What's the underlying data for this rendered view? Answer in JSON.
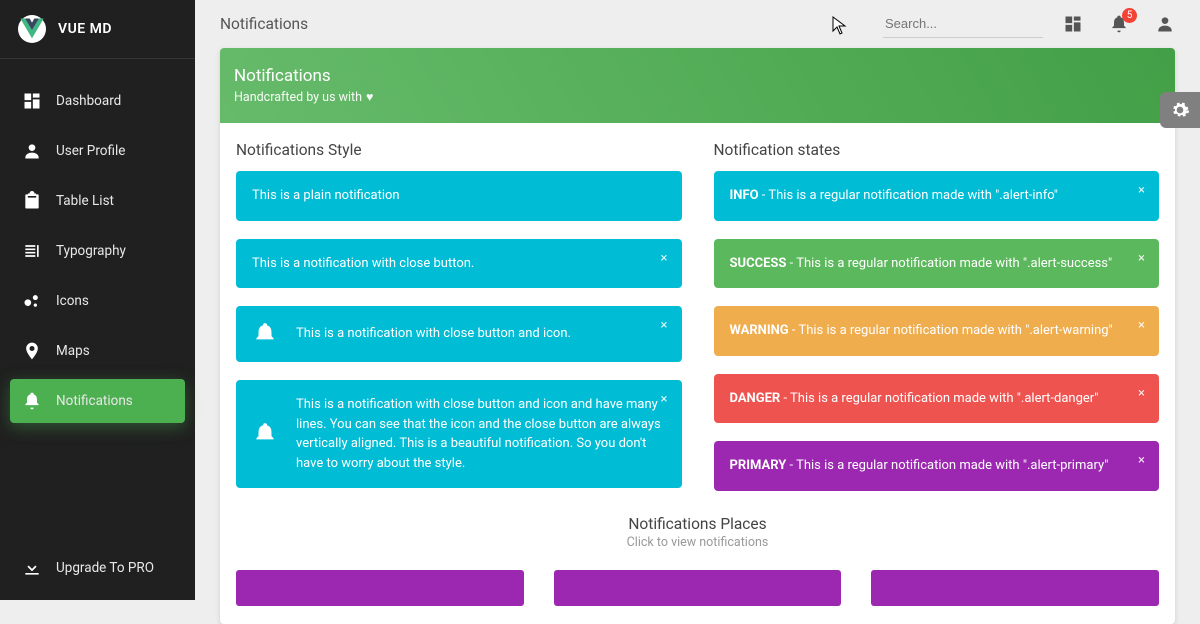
{
  "brand": {
    "name": "VUE MD"
  },
  "sidebar": {
    "items": [
      {
        "label": "Dashboard"
      },
      {
        "label": "User Profile"
      },
      {
        "label": "Table List"
      },
      {
        "label": "Typography"
      },
      {
        "label": "Icons"
      },
      {
        "label": "Maps"
      },
      {
        "label": "Notifications"
      }
    ],
    "upgrade": {
      "label": "Upgrade To PRO"
    }
  },
  "topbar": {
    "title": "Notifications",
    "search_placeholder": "Search...",
    "badge_count": "5"
  },
  "card": {
    "title": "Notifications",
    "subtitle": "Handcrafted by us with"
  },
  "style_section": {
    "title": "Notifications Style",
    "alerts": [
      {
        "text": "This is a plain notification"
      },
      {
        "text": "This is a notification with close button."
      },
      {
        "text": "This is a notification with close button and icon."
      },
      {
        "text": "This is a notification with close button and icon and have many lines. You can see that the icon and the close button are always vertically aligned. This is a beautiful notification. So you don't have to worry about the style."
      }
    ]
  },
  "states_section": {
    "title": "Notification states",
    "alerts": [
      {
        "label": "INFO",
        "text": " - This is a regular notification made with \".alert-info\""
      },
      {
        "label": "SUCCESS",
        "text": " - This is a regular notification made with \".alert-success\""
      },
      {
        "label": "WARNING",
        "text": " - This is a regular notification made with \".alert-warning\""
      },
      {
        "label": "DANGER",
        "text": " - This is a regular notification made with \".alert-danger\""
      },
      {
        "label": "PRIMARY",
        "text": " - This is a regular notification made with \".alert-primary\""
      }
    ]
  },
  "places": {
    "title": "Notifications Places",
    "subtitle": "Click to view notifications"
  }
}
